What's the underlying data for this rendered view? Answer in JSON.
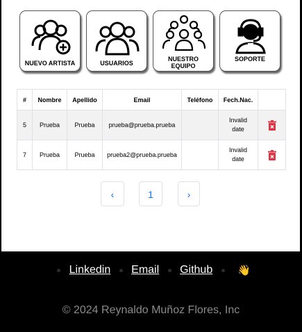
{
  "tiles": [
    {
      "label": "NUEVO ARTISTA",
      "icon": "add-user-icon"
    },
    {
      "label": "USUARIOS",
      "icon": "users-group-icon"
    },
    {
      "label_line1": "NUESTRO",
      "label_line2": "EQUIPO",
      "icon": "team-icon"
    },
    {
      "label": "SOPORTE",
      "icon": "support-agent-icon"
    }
  ],
  "table": {
    "headers": [
      "#",
      "Nombre",
      "Apellido",
      "Email",
      "Teléfono",
      "Fech.Nac.",
      ""
    ],
    "rows": [
      {
        "id": "5",
        "nombre": "Prueba",
        "apellido": "Prueba",
        "email": "prueba@prueba.prueba",
        "telefono": "",
        "fecha_l1": "Invalid",
        "fecha_l2": "date",
        "action_icon": "trash-icon"
      },
      {
        "id": "7",
        "nombre": "Prueba",
        "apellido": "Prueba",
        "email": "prueba2@prueba.prueba",
        "telefono": "",
        "fecha_l1": "Invalid",
        "fecha_l2": "date",
        "action_icon": "trash-icon"
      }
    ]
  },
  "pagination": {
    "prev": "‹",
    "current": "1",
    "next": "›"
  },
  "footer": {
    "links": [
      "Linkedin",
      "Email",
      "Github"
    ],
    "wave": "👋",
    "copyright": "© 2024 Reynaldo Muñoz Flores, Inc"
  },
  "colors": {
    "accent": "#0d6efd",
    "danger": "#dc3545",
    "footer_bg": "#000000"
  }
}
